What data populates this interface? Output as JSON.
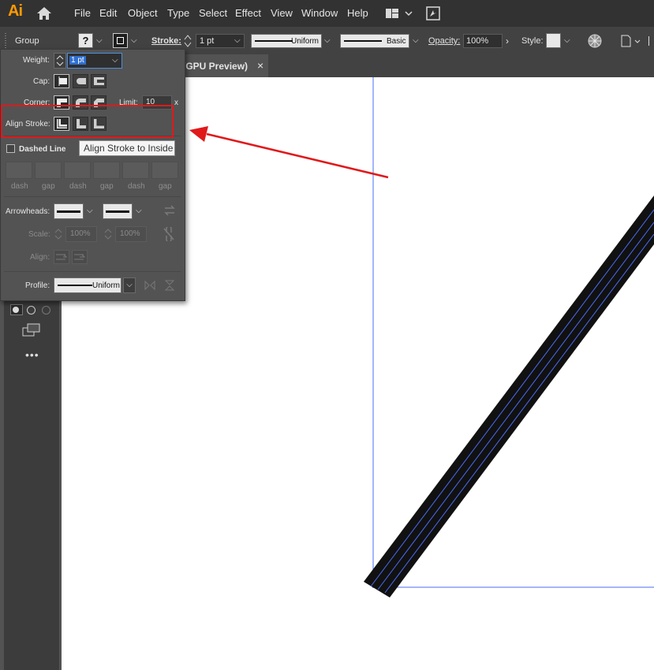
{
  "app": {
    "logo": "Ai"
  },
  "menu": [
    "File",
    "Edit",
    "Object",
    "Type",
    "Select",
    "Effect",
    "View",
    "Window",
    "Help"
  ],
  "control_bar": {
    "selection_label": "Group",
    "fill_value": "?",
    "stroke_label": "Stroke:",
    "stroke_weight": "1 pt",
    "variable_width": "Uniform",
    "brush": "Basic",
    "opacity_label": "Opacity:",
    "opacity_value": "100%",
    "style_label": "Style:"
  },
  "document_tab": {
    "title": "/GPU Preview)",
    "close": "×"
  },
  "stroke_panel": {
    "weight_label": "Weight:",
    "weight_value": "1 pt",
    "cap_label": "Cap:",
    "corner_label": "Corner:",
    "limit_label": "Limit:",
    "limit_value": "10",
    "limit_unit": "x",
    "align_stroke_label": "Align Stroke:",
    "dashed_line_label": "Dashed Line",
    "dashed_line_checked": false,
    "dash_gap_labels": [
      "dash",
      "gap",
      "dash",
      "gap",
      "dash",
      "gap"
    ],
    "arrowheads_label": "Arrowheads:",
    "scale_label": "Scale:",
    "scale_start": "100%",
    "scale_end": "100%",
    "align_label": "Align:",
    "profile_label": "Profile:",
    "profile_value": "Uniform"
  },
  "tooltip": "Align Stroke to Inside",
  "colors": {
    "highlight": "#e0191b",
    "guide": "#4a6cf7",
    "stroke": "#111111"
  }
}
